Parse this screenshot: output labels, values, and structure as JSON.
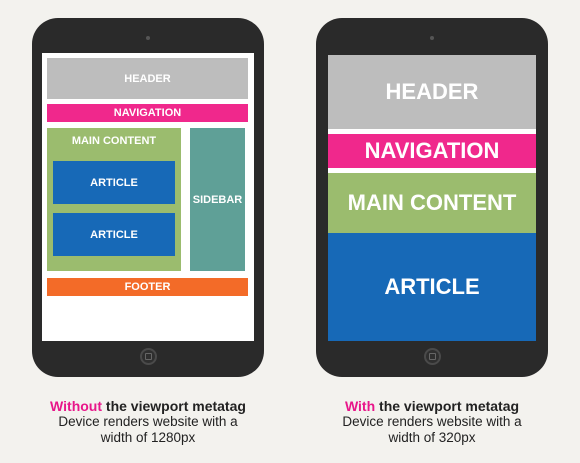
{
  "left": {
    "header": "HEADER",
    "navigation": "NAVIGATION",
    "main_content": "MAIN CONTENT",
    "article_1": "ARTICLE",
    "article_2": "ARTICLE",
    "sidebar": "SIDEBAR",
    "footer": "FOOTER",
    "caption": {
      "highlight": "Without",
      "rest": " the viewport metatag",
      "line2": "Device renders website with a",
      "line3": "width of 1280px"
    }
  },
  "right": {
    "header": "HEADER",
    "navigation": "NAVIGATION",
    "main_content": "MAIN CONTENT",
    "article": "ARTICLE",
    "caption": {
      "highlight": "With",
      "rest": " the viewport metatag",
      "line2": "Device renders website with a",
      "line3": "width of 320px"
    }
  },
  "colors": {
    "header": "#bdbdbd",
    "navigation": "#f0288c",
    "main_content": "#9bbc6e",
    "article": "#1769b7",
    "sidebar": "#5fa097",
    "footer": "#f36b28",
    "highlight_text": "#e8168a"
  }
}
